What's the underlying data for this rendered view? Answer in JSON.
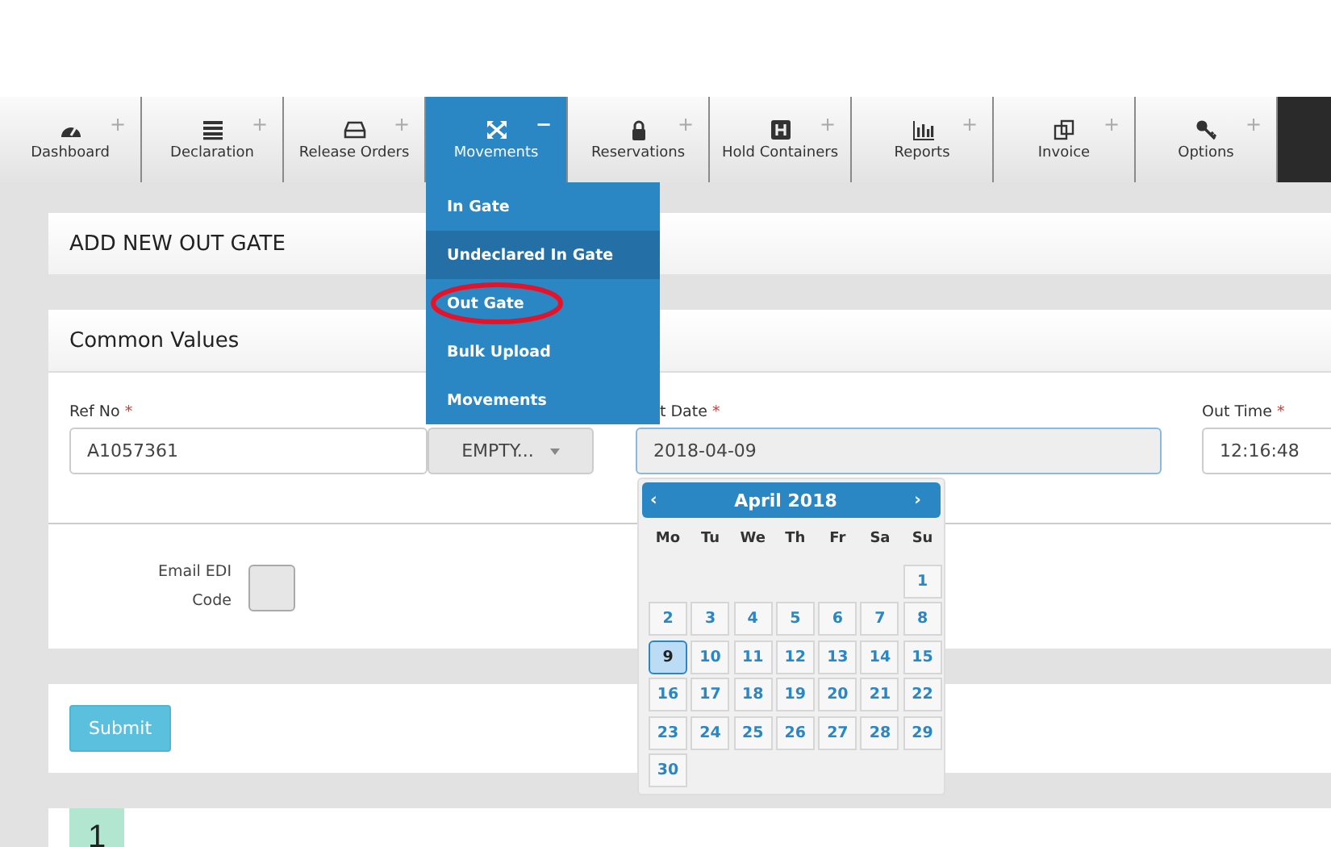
{
  "nav": {
    "tabs": [
      {
        "label": "Dashboard",
        "toggle": "+",
        "selected": false
      },
      {
        "label": "Declaration",
        "toggle": "+",
        "selected": false
      },
      {
        "label": "Release Orders",
        "toggle": "+",
        "selected": false
      },
      {
        "label": "Movements",
        "toggle": "−",
        "selected": true
      },
      {
        "label": "Reservations",
        "toggle": "+",
        "selected": false
      },
      {
        "label": "Hold Containers",
        "toggle": "+",
        "selected": false
      },
      {
        "label": "Reports",
        "toggle": "+",
        "selected": false
      },
      {
        "label": "Invoice",
        "toggle": "+",
        "selected": false
      },
      {
        "label": "Options",
        "toggle": "+",
        "selected": false
      }
    ],
    "dropdown": [
      {
        "label": "In Gate",
        "highlighted": false,
        "circled": false
      },
      {
        "label": "Undeclared In Gate",
        "highlighted": true,
        "circled": false
      },
      {
        "label": "Out Gate",
        "highlighted": false,
        "circled": true
      },
      {
        "label": "Bulk Upload",
        "highlighted": false,
        "circled": false
      },
      {
        "label": "Movements",
        "highlighted": false,
        "circled": false
      }
    ]
  },
  "page_title": "ADD NEW OUT GATE",
  "common_values": {
    "title": "Common Values",
    "fields": [
      {
        "kind": "text",
        "label": "Ref No",
        "required_mark": "*",
        "value": "A1057361"
      },
      {
        "kind": "select",
        "value": "EMPTY..."
      },
      {
        "kind": "date",
        "label": "t Date",
        "required_mark": "*",
        "value": "2018-04-09"
      },
      {
        "kind": "time",
        "label": "Out Time",
        "required_mark": "*",
        "value": "12:16:48"
      }
    ],
    "email_edi": {
      "label_line1": "Email EDI",
      "label_line2": "Code",
      "checked": false
    }
  },
  "datepicker": {
    "prev": "‹",
    "month": "April 2018",
    "next": "›",
    "weekdays": [
      "Mo",
      "Tu",
      "We",
      "Th",
      "Fr",
      "Sa",
      "Su"
    ],
    "weeks": [
      [
        {
          "day": "1",
          "selected": false
        }
      ],
      [
        {
          "day": "2",
          "selected": false
        },
        {
          "day": "3",
          "selected": false
        },
        {
          "day": "4",
          "selected": false
        },
        {
          "day": "5",
          "selected": false
        },
        {
          "day": "6",
          "selected": false
        },
        {
          "day": "7",
          "selected": false
        },
        {
          "day": "8",
          "selected": false
        }
      ],
      [
        {
          "day": "9",
          "selected": true
        },
        {
          "day": "10",
          "selected": false
        },
        {
          "day": "11",
          "selected": false
        },
        {
          "day": "12",
          "selected": false
        },
        {
          "day": "13",
          "selected": false
        },
        {
          "day": "14",
          "selected": false
        },
        {
          "day": "15",
          "selected": false
        }
      ],
      [
        {
          "day": "16",
          "selected": false
        },
        {
          "day": "17",
          "selected": false
        },
        {
          "day": "18",
          "selected": false
        },
        {
          "day": "19",
          "selected": false
        },
        {
          "day": "20",
          "selected": false
        },
        {
          "day": "21",
          "selected": false
        },
        {
          "day": "22",
          "selected": false
        }
      ],
      [
        {
          "day": "23",
          "selected": false
        },
        {
          "day": "24",
          "selected": false
        },
        {
          "day": "25",
          "selected": false
        },
        {
          "day": "26",
          "selected": false
        },
        {
          "day": "27",
          "selected": false
        },
        {
          "day": "28",
          "selected": false
        },
        {
          "day": "29",
          "selected": false
        }
      ],
      [
        {
          "day": "30",
          "selected": false
        }
      ]
    ]
  },
  "submit": "Submit",
  "step_badge": "1"
}
